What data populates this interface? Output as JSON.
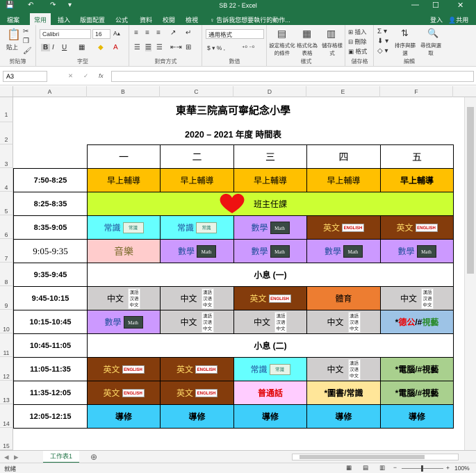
{
  "window": {
    "title": "SB 22 - Excel",
    "min": "—",
    "max": "☐",
    "close": "✕"
  },
  "quick_access": {
    "save": "💾",
    "undo": "↶",
    "redo": "↷",
    "more": "▾"
  },
  "tabs": [
    {
      "label": "檔案"
    },
    {
      "label": "常用"
    },
    {
      "label": "插入"
    },
    {
      "label": "版面配置"
    },
    {
      "label": "公式"
    },
    {
      "label": "資料"
    },
    {
      "label": "校閱"
    },
    {
      "label": "檢視"
    }
  ],
  "tell_me": "♀ 告訴我您想要執行的動作...",
  "sign_in": "登入",
  "share": "共用",
  "ribbon": {
    "clipboard": {
      "label": "剪貼簿",
      "paste": "貼上"
    },
    "font": {
      "label": "字型",
      "name": "Calibri",
      "size": "16",
      "bold": "B",
      "italic": "I",
      "underline": "U"
    },
    "alignment": {
      "label": "對齊方式"
    },
    "number": {
      "label": "數值",
      "format": "通用格式"
    },
    "styles": {
      "label": "樣式",
      "cond": "設定格式化的條件",
      "table": "格式化為表格",
      "cell": "儲存格樣式"
    },
    "cells": {
      "label": "儲存格",
      "insert": "插入",
      "delete": "刪除",
      "format": "格式"
    },
    "editing": {
      "label": "編輯",
      "sort": "排序與篩選",
      "find": "尋找與選取"
    }
  },
  "formula_bar": {
    "name_box": "A3",
    "fx": "fx",
    "value": ""
  },
  "columns": [
    "A",
    "B",
    "C",
    "D",
    "E",
    "F"
  ],
  "rows": [
    "1",
    "2",
    "3",
    "4",
    "5",
    "6",
    "7",
    "8",
    "9",
    "10",
    "11",
    "12",
    "13",
    "14",
    "15"
  ],
  "sheet": {
    "title": "東華三院高可寧紀念小學",
    "subtitle": "2020 – 2021 年度 時間表",
    "days": [
      "一",
      "二",
      "三",
      "四",
      "五"
    ],
    "times": [
      "7:50-8:25",
      "8:25-8:35",
      "8:35-9:05",
      "9:05-9:35",
      "9:35-9:45",
      "9:45-10:15",
      "10:15-10:45",
      "10:45-11:05",
      "11:05-11:35",
      "11:35-12:05",
      "12:05-12:15"
    ],
    "morning": [
      "早上輔導",
      "早上輔導",
      "早上輔導",
      "早上輔導",
      "早上輔導"
    ],
    "class_teacher": "班主任課",
    "row6": [
      "常識",
      "常識",
      "數學",
      "英文",
      "英文"
    ],
    "row7": [
      "音樂",
      "數學",
      "數學",
      "數學",
      "數學"
    ],
    "break1": "小息 (一)",
    "row9": [
      "中文",
      "中文",
      "英文",
      "體育",
      "中文"
    ],
    "row10a": [
      "數學",
      "中文",
      "中文",
      "中文"
    ],
    "row10_fri": {
      "p1": "*",
      "p2": "德公",
      "p3": "/#",
      "p4": "視藝"
    },
    "break2": "小息 (二)",
    "row12": [
      "英文",
      "英文",
      "常識",
      "中文",
      "*電腦/#視藝"
    ],
    "row13": [
      "英文",
      "英文",
      "普通話",
      "*圖書/常識",
      "*電腦/#視藝"
    ],
    "row14": [
      "導修",
      "導修",
      "導修",
      "導修",
      "導修"
    ],
    "icons": {
      "math": "Math",
      "english": "ENGLISH",
      "general": "常識",
      "chinese": "漢語 汉语 中文"
    }
  },
  "sheet_tab": "工作表1",
  "add_sheet": "⊕",
  "status": {
    "ready": "就緒",
    "zoom": "100%"
  },
  "colors": {
    "excel_green": "#217346",
    "orange": "#FFC000",
    "lime": "#CCFF33",
    "cyan": "#66FFFF",
    "violet": "#CC99FF",
    "brown": "#843C0C",
    "pink": "#FFCCCC",
    "grey": "#D0CECE",
    "sky": "#3ECEFA",
    "sage": "#A9D08E",
    "yellow": "#FFE699",
    "lightpink": "#FFCCFF"
  }
}
